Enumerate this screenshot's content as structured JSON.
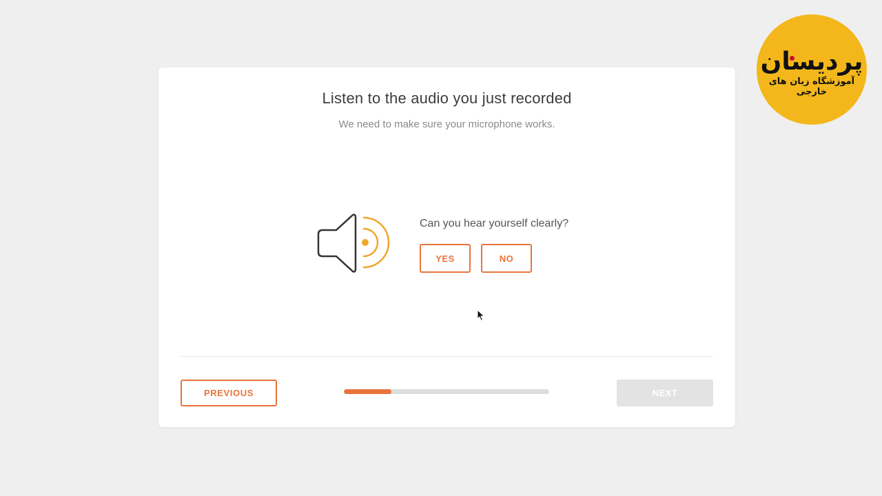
{
  "card": {
    "title": "Listen to the audio you just recorded",
    "subtitle": "We need to make sure your microphone works."
  },
  "question": {
    "text": "Can you hear yourself clearly?",
    "yes_label": "YES",
    "no_label": "NO"
  },
  "footer": {
    "previous_label": "PREVIOUS",
    "next_label": "NEXT",
    "progress_fraction": 0.23
  },
  "logo": {
    "name": "پردیسان",
    "tagline": "آموزشگاه زبان های خارجی"
  },
  "colors": {
    "accent": "#e8743b",
    "speaker_waves": "#f0a62a",
    "background": "#efefef",
    "logo_bg": "#f3b71b"
  }
}
